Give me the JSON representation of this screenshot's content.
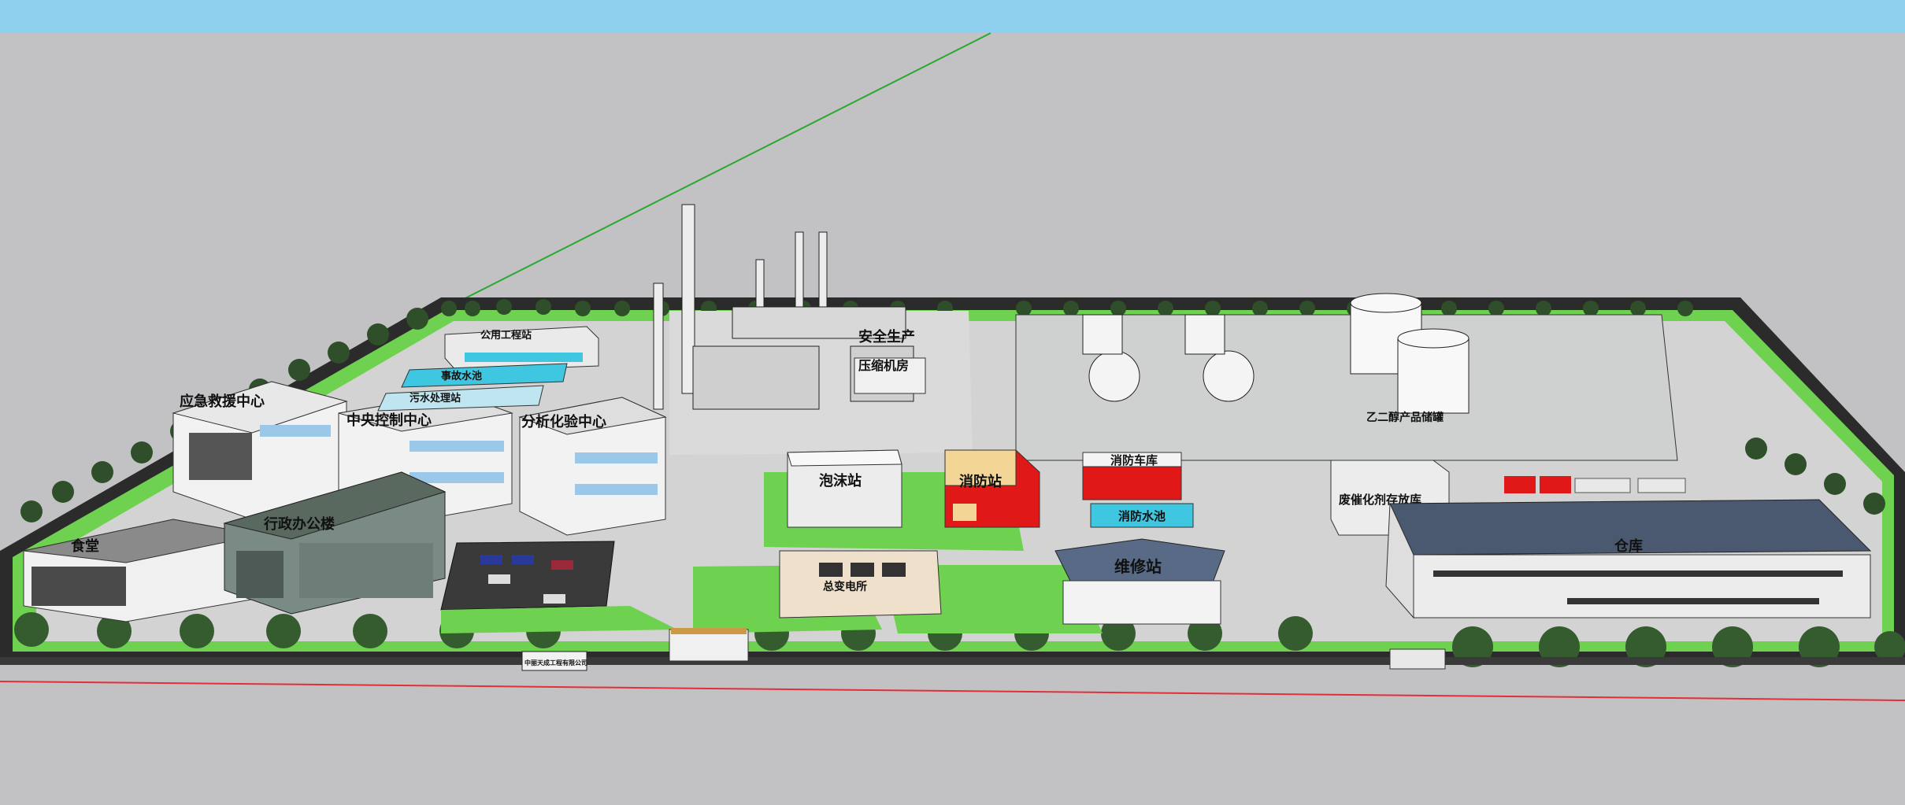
{
  "scene": {
    "colors": {
      "sky": "#8fd0ee",
      "ground": "#c2c2c5",
      "grass": "#6fd150",
      "road": "#2b2b2b",
      "pavement": "#d3d3d3",
      "fire_red": "#e01818",
      "water": "#3fc6e0",
      "axis_green": "#2aa830",
      "axis_red": "#e0303a"
    },
    "labels": {
      "emergency_center": "应急救援中心",
      "central_control": "中央控制中心",
      "analysis_lab": "分析化验中心",
      "admin_office": "行政办公楼",
      "canteen": "食堂",
      "safety_production": "安全生产",
      "compressor_room": "压缩机房",
      "foam_station": "泡沫站",
      "fire_station": "消防站",
      "fire_garage": "消防车库",
      "fire_pool": "消防水池",
      "maintenance_station": "维修站",
      "product_tank_area": "乙二醇产品储罐",
      "waste_area": "废催化剂存放库",
      "warehouse": "仓库",
      "company_sign": "中丽天成工程有限公司",
      "utility_building": "公用工程站",
      "pool_a": "事故水池",
      "pool_b": "污水处理站",
      "substation": "总变电所"
    }
  }
}
